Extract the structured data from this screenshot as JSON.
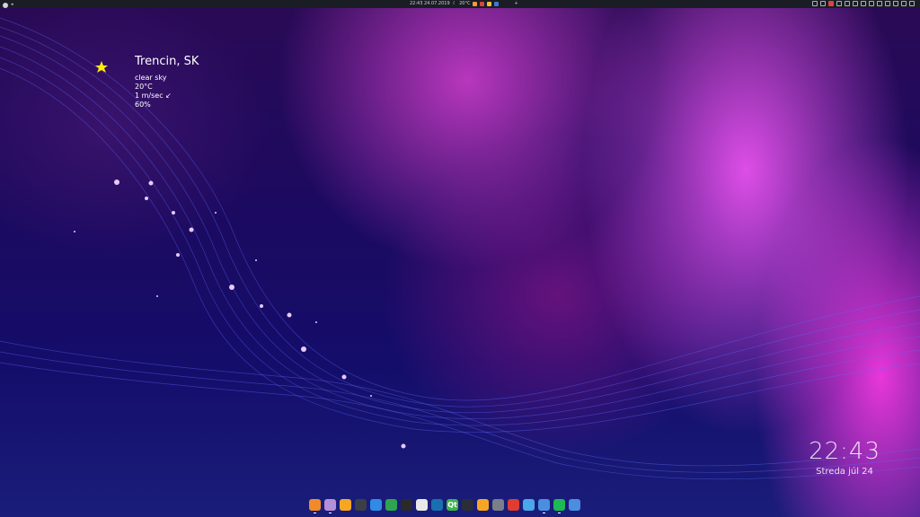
{
  "topbar": {
    "clock_text": "22:43 24.07.2019",
    "weather_text": "20°C",
    "left_icon": "system-logo-icon",
    "center_icons": [
      {
        "name": "moon-icon",
        "color": "#e6d65c"
      },
      {
        "name": "app-orange-icon",
        "color": "#f29b3a"
      },
      {
        "name": "app-red-icon",
        "color": "#d8463e"
      },
      {
        "name": "app-yellow-icon",
        "color": "#f0c040"
      },
      {
        "name": "app-blue-icon",
        "color": "#3a7bd5"
      }
    ],
    "right_icons": [
      "display-icon",
      "notes-icon",
      "app-icon",
      "network-icon",
      "mic-icon",
      "settings-icon",
      "pen-icon",
      "window-icon",
      "battery-icon",
      "volume-icon",
      "bluetooth-icon",
      "calendar-icon",
      "power-icon"
    ]
  },
  "weather": {
    "city": "Trencin, SK",
    "condition": "clear sky",
    "temperature": "20°C",
    "wind": "1 m/sec ↙",
    "humidity": "60%",
    "icon": "crescent-moon-star-icon"
  },
  "clock": {
    "time": "22:43",
    "date": "Streda júl 24"
  },
  "dock": {
    "items": [
      {
        "name": "browser-icon",
        "color": "#f08a2a",
        "glyph": "",
        "running": true
      },
      {
        "name": "files-icon",
        "color": "#b38fd8",
        "glyph": "",
        "running": true
      },
      {
        "name": "folder-icon",
        "color": "#f6a623",
        "glyph": "",
        "running": false
      },
      {
        "name": "terminal-icon",
        "color": "#3c3f45",
        "glyph": "",
        "running": false
      },
      {
        "name": "docs-icon",
        "color": "#2f8be6",
        "glyph": "",
        "running": false
      },
      {
        "name": "spreadsheet-icon",
        "color": "#2ea44f",
        "glyph": "",
        "running": false
      },
      {
        "name": "clapper-icon",
        "color": "#2a2a2a",
        "glyph": "",
        "running": false
      },
      {
        "name": "vpn-icon",
        "color": "#e8e8e8",
        "glyph": "",
        "running": false
      },
      {
        "name": "remote-icon",
        "color": "#1a6fb0",
        "glyph": "",
        "running": false
      },
      {
        "name": "qt-icon",
        "color": "#41b34a",
        "glyph": "Qt",
        "running": false
      },
      {
        "name": "gamepad-icon",
        "color": "#2b2e38",
        "glyph": "",
        "running": false
      },
      {
        "name": "download-icon",
        "color": "#f6a623",
        "glyph": "",
        "running": false
      },
      {
        "name": "media-player-icon",
        "color": "#7a7f8a",
        "glyph": "",
        "running": false
      },
      {
        "name": "package-icon",
        "color": "#e03c31",
        "glyph": "",
        "running": false
      },
      {
        "name": "chat-icon",
        "color": "#4aa8e8",
        "glyph": "",
        "running": false
      },
      {
        "name": "anchor-icon",
        "color": "#4b8ee0",
        "glyph": "",
        "running": true
      },
      {
        "name": "spotify-icon",
        "color": "#1db954",
        "glyph": "",
        "running": true
      },
      {
        "name": "anchor-app-icon",
        "color": "#4b8ee0",
        "glyph": "",
        "running": false
      }
    ]
  }
}
